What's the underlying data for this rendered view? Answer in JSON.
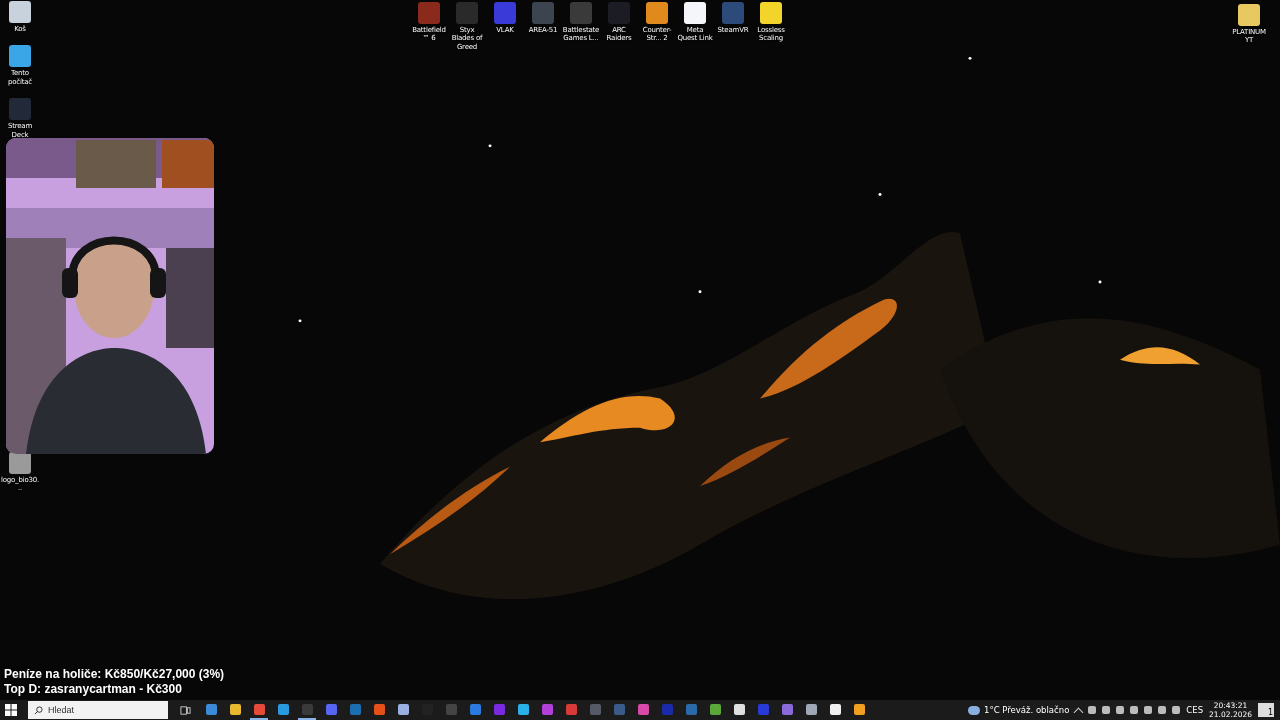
{
  "desktop_top": [
    {
      "label": "Battlefield™ 6",
      "color": "#8a2a1c"
    },
    {
      "label": "Styx Blades of Greed",
      "color": "#2a2a2a"
    },
    {
      "label": "VLAK",
      "color": "#3a3ad8"
    },
    {
      "label": "AREA-51",
      "color": "#3c4450"
    },
    {
      "label": "Battlestate Games L...",
      "color": "#3a3a3a"
    },
    {
      "label": "ARC Raiders",
      "color": "#1c1c24"
    },
    {
      "label": "Counter-Str... 2",
      "color": "#e08a1e"
    },
    {
      "label": "Meta Quest Link",
      "color": "#f4f6fa"
    },
    {
      "label": "SteamVR",
      "color": "#2c4a7a"
    },
    {
      "label": "Lossless Scaling",
      "color": "#f2d42a"
    }
  ],
  "desktop_left": [
    {
      "label": "Koš",
      "color": "#c8d2dc"
    },
    {
      "label": "Tento počítač",
      "color": "#3aa6e8"
    },
    {
      "label": "Stream Deck",
      "color": "#222a3a"
    }
  ],
  "desktop_left_bottom": [
    {
      "label": "logo_bio30...",
      "color": "#9a9a9a"
    }
  ],
  "desktop_right": [
    {
      "label": "PLATINUM YT",
      "color": "#e8c860"
    }
  ],
  "stream_overlay": {
    "goal": "Peníze na holiče: Kč850/Kč27,000 (3%)",
    "top_donor": "Top D: zasranycartman - Kč300"
  },
  "taskbar": {
    "search_placeholder": "Hledat",
    "apps": [
      {
        "color": "#3a8ad8",
        "running": false
      },
      {
        "color": "#e8b830",
        "running": false
      },
      {
        "color": "#e84a3a",
        "running": true
      },
      {
        "color": "#2a9ae0",
        "running": false
      },
      {
        "color": "#3a3a3a",
        "running": true
      },
      {
        "color": "#5865f2",
        "running": false
      },
      {
        "color": "#1b6fb0",
        "running": false
      },
      {
        "color": "#e8501a",
        "running": false
      },
      {
        "color": "#9ab0e0",
        "running": false
      },
      {
        "color": "#222222",
        "running": false
      },
      {
        "color": "#444444",
        "running": false
      },
      {
        "color": "#2a7ae0",
        "running": false
      },
      {
        "color": "#7a2ae0",
        "running": false
      },
      {
        "color": "#2ab0e8",
        "running": false
      },
      {
        "color": "#b040d8",
        "running": false
      },
      {
        "color": "#d83a3a",
        "running": false
      },
      {
        "color": "#555a66",
        "running": false
      },
      {
        "color": "#3a5a8a",
        "running": false
      },
      {
        "color": "#d84aa8",
        "running": false
      },
      {
        "color": "#1a2aa8",
        "running": false
      },
      {
        "color": "#2a6aa8",
        "running": false
      },
      {
        "color": "#5aa83a",
        "running": false
      },
      {
        "color": "#e0e0e0",
        "running": false
      },
      {
        "color": "#2a3ad8",
        "running": false
      },
      {
        "color": "#8a6ad8",
        "running": false
      },
      {
        "color": "#a0a8b8",
        "running": false
      },
      {
        "color": "#f0f0f0",
        "running": false
      },
      {
        "color": "#f0a020",
        "running": false
      }
    ],
    "weather": "1°C  Převáž. oblačno",
    "language": "CES",
    "time": "20:43:21",
    "date": "21.02.2026",
    "notifications": "1"
  }
}
